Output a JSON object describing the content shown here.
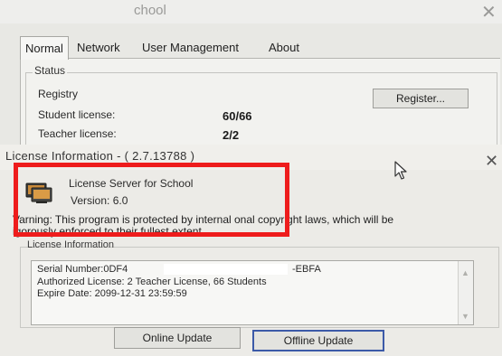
{
  "back_window": {
    "title": "chool",
    "close_glyph": "✕",
    "tabs": [
      {
        "label": "Normal"
      },
      {
        "label": "Network"
      },
      {
        "label": "User Management"
      },
      {
        "label": "About"
      }
    ],
    "status_group_label": "Status",
    "rows": [
      {
        "label": "Registry",
        "value": ""
      },
      {
        "label": "Student license:",
        "value": "60/66"
      },
      {
        "label": "Teacher license:",
        "value": "2/2"
      }
    ],
    "register_button": "Register..."
  },
  "dialog": {
    "title": "License Information - ( 2.7.13788 )",
    "close_glyph": "✕",
    "product_name": "License Server for School",
    "version": "Version: 6.0",
    "warning_line1": "Varning: This program is protected by internal onal copyright laws, which will be",
    "warning_line2": "igorously enforced to their fullest extent.",
    "info_group_label": "License Information",
    "info_lines": [
      {
        "text": "Serial Number:0DF4"
      },
      {
        "text": "Authorized License: 2 Teacher License, 66 Students"
      },
      {
        "text": "Expire Date: 2099-12-31 23:59:59"
      }
    ],
    "serial_suffix": "-EBFA",
    "online_update_button": "Online Update",
    "offline_update_button": "Offline Update",
    "scroll_up_glyph": "▲",
    "scroll_down_glyph": "▼"
  },
  "colors": {
    "highlight": "#ee1c1c",
    "focused_button_border": "#3c5aa8"
  }
}
